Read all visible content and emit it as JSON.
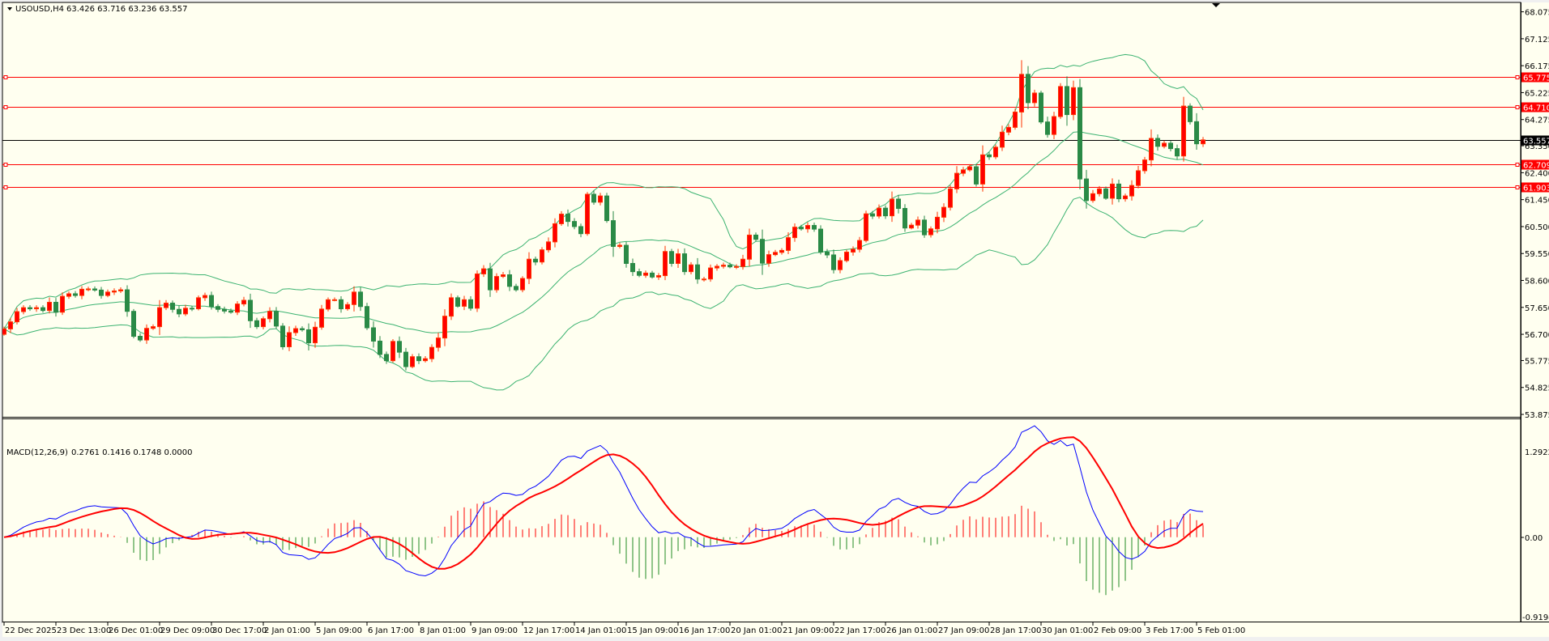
{
  "header": {
    "symbol": "USOUSD,H4",
    "ohlc": "63.426 63.716 63.236 63.557",
    "menu_icon": "triangle-down-icon"
  },
  "colors": {
    "background": "#FFFFF0",
    "bull_candle": "#FF0000",
    "bull_border": "#FF3300",
    "bear_candle": "#2A8A46",
    "bollinger": "#3CB371",
    "hline": "#FF0000",
    "bid_line": "#000000",
    "macd_line": "#0000FF",
    "signal_line": "#FF0000",
    "hist_pos": "#FF0000",
    "hist_neg": "#228B22"
  },
  "macd_panel": {
    "label": "MACD(12,26,9)",
    "values": "0.2761 0.1416 0.1748 0.0000",
    "axis_labels": [
      "1.2922",
      "0.00",
      "-0.9194"
    ]
  },
  "price_axis": {
    "labels": [
      "68.075",
      "67.125",
      "66.175",
      "65.225",
      "64.275",
      "63.350",
      "62.400",
      "61.450",
      "60.500",
      "59.550",
      "58.600",
      "57.650",
      "56.700",
      "55.775",
      "54.825",
      "53.875"
    ]
  },
  "levels": [
    {
      "value": "65.775",
      "type": "hline"
    },
    {
      "value": "64.710",
      "type": "hline"
    },
    {
      "value": "62.709",
      "type": "hline"
    },
    {
      "value": "61.903",
      "type": "hline"
    },
    {
      "value": "63.557",
      "type": "bid"
    }
  ],
  "time_axis": {
    "labels": [
      "22 Dec 2025",
      "23 Dec 13:00",
      "26 Dec 01:00",
      "29 Dec 09:00",
      "30 Dec 17:00",
      "2 Jan 01:00",
      "5 Jan 09:00",
      "6 Jan 17:00",
      "8 Jan 01:00",
      "9 Jan 09:00",
      "12 Jan 17:00",
      "14 Jan 01:00",
      "15 Jan 09:00",
      "16 Jan 17:00",
      "20 Jan 01:00",
      "21 Jan 09:00",
      "22 Jan 17:00",
      "26 Jan 01:00",
      "27 Jan 09:00",
      "28 Jan 17:00",
      "30 Jan 01:00",
      "2 Feb 09:00",
      "3 Feb 17:00",
      "5 Feb 01:00"
    ]
  },
  "chart_data": [
    {
      "type": "candlestick",
      "title": "USOUSD,H4",
      "timeframe": "H4",
      "ylim": [
        53.875,
        68.075
      ],
      "indicators": [
        "Bollinger Bands",
        "MACD(12,26,9)"
      ],
      "first_open": 56.7,
      "closes": [
        56.89,
        57.14,
        57.5,
        57.64,
        57.6,
        57.64,
        57.54,
        57.83,
        57.48,
        58.04,
        58.13,
        58.07,
        58.29,
        58.3,
        58.26,
        58.07,
        58.19,
        58.23,
        58.27,
        57.51,
        56.63,
        56.5,
        56.91,
        56.97,
        57.64,
        57.8,
        57.58,
        57.42,
        57.62,
        57.6,
        57.99,
        58.07,
        57.68,
        57.58,
        57.52,
        57.48,
        57.77,
        57.9,
        57.18,
        56.97,
        57.25,
        57.51,
        56.99,
        56.26,
        56.76,
        56.9,
        56.86,
        56.4,
        56.95,
        57.59,
        57.92,
        57.92,
        57.6,
        57.75,
        58.19,
        57.68,
        56.93,
        56.46,
        55.99,
        55.77,
        56.45,
        56.07,
        55.56,
        55.91,
        55.77,
        55.84,
        56.24,
        56.57,
        57.34,
        57.99,
        57.69,
        57.92,
        57.62,
        58.83,
        59.01,
        58.27,
        58.74,
        58.8,
        58.39,
        58.27,
        58.67,
        59.35,
        59.25,
        59.68,
        59.96,
        60.6,
        60.94,
        60.68,
        60.5,
        60.25,
        61.64,
        61.36,
        61.58,
        60.71,
        59.8,
        59.84,
        59.2,
        58.91,
        58.78,
        58.86,
        58.72,
        58.77,
        59.62,
        59.2,
        59.54,
        58.91,
        59.15,
        58.65,
        58.65,
        59.04,
        59.1,
        59.14,
        59.08,
        59.09,
        59.35,
        60.2,
        60.05,
        59.21,
        59.51,
        59.59,
        59.66,
        60.11,
        60.48,
        60.42,
        60.54,
        60.41,
        59.6,
        59.5,
        58.98,
        59.3,
        59.6,
        59.7,
        60.01,
        60.95,
        60.87,
        61.15,
        60.88,
        61.47,
        61.14,
        60.45,
        60.55,
        60.73,
        60.21,
        60.42,
        60.83,
        61.18,
        61.83,
        62.38,
        62.5,
        62.61,
        62.0,
        63.03,
        62.96,
        63.3,
        63.83,
        64.0,
        64.54,
        65.87,
        64.87,
        65.21,
        64.19,
        63.75,
        64.38,
        65.44,
        64.45,
        65.4,
        62.18,
        61.42,
        61.66,
        61.83,
        61.5,
        62.0,
        61.48,
        61.58,
        61.95,
        62.47,
        62.85,
        63.61,
        63.33,
        63.44,
        63.25,
        62.99,
        64.75,
        64.2,
        63.42,
        63.557
      ]
    }
  ]
}
